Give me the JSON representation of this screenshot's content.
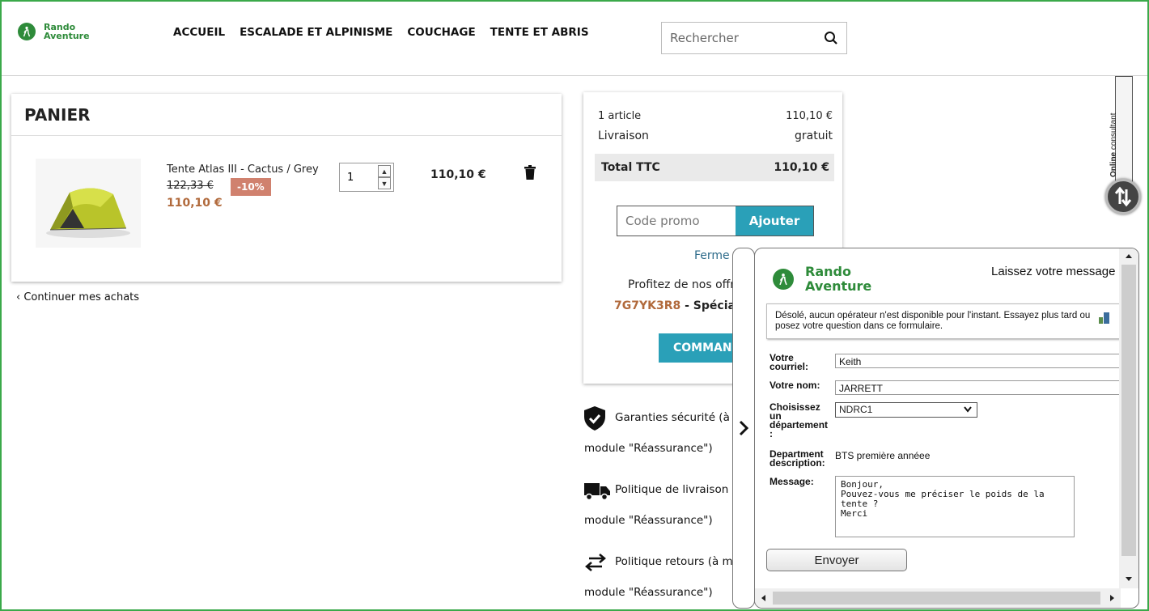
{
  "brand": {
    "line1": "Rando",
    "line2": "Aventure"
  },
  "nav": [
    "ACCUEIL",
    "ESCALADE ET ALPINISME",
    "COUCHAGE",
    "TENTE ET ABRIS"
  ],
  "search": {
    "placeholder": "Rechercher"
  },
  "cart": {
    "title": "PANIER",
    "product": {
      "name": "Tente Atlas III - Cactus / Grey",
      "old_price": "122,33 €",
      "discount": "-10%",
      "price": "110,10 €",
      "quantity": "1",
      "line_total": "110,10 €"
    },
    "continue_label": "Continuer mes achats"
  },
  "summary": {
    "items_label": "1 article",
    "items_value": "110,10 €",
    "shipping_label": "Livraison",
    "shipping_value": "gratuit",
    "total_label": "Total TTC",
    "total_value": "110,10 €",
    "promo_placeholder": "Code promo",
    "promo_button": "Ajouter",
    "close_label": "Ferme",
    "offers_text": "Profitez de nos offre",
    "promo_code": "7G7YK3R8",
    "promo_code_suffix": " - Spécial r",
    "order_button": "COMMAN"
  },
  "reassurance": [
    {
      "icon": "shield-check-icon",
      "title": "Garanties sécurité (à n",
      "sub": "module \"Réassurance\")"
    },
    {
      "icon": "truck-icon",
      "title": "Politique de livraison (",
      "sub": "module \"Réassurance\")"
    },
    {
      "icon": "exchange-arrows-icon",
      "title": "Politique retours (à mo",
      "sub": "module \"Réassurance\")"
    }
  ],
  "online_consultant": {
    "bold": "Online",
    "rest": " consultant"
  },
  "chat": {
    "brand_line1": "Rando",
    "brand_line2": "Aventure",
    "header": "Laissez votre message",
    "notice": "Désolé, aucun opérateur n'est disponible pour l'instant. Essayez plus tard ou posez votre question dans ce formulaire.",
    "email_label": "Votre courriel:",
    "email_value": "Keith",
    "name_label": "Votre nom:",
    "name_value": "JARRETT",
    "dept_label": "Choisissez un département :",
    "dept_value": "NDRC1",
    "desc_label": "Department description:",
    "desc_value": "BTS première annéee",
    "message_label": "Message:",
    "message_value": "Bonjour,\nPouvez-vous me préciser le poids de la tente ?\nMerci",
    "send_button": "Envoyer"
  },
  "colors": {
    "brand_green": "#2e8b3a",
    "accent_teal": "#2aa0b8",
    "price_brown": "#b16a3c",
    "discount_bg": "#d0816e",
    "frame_green": "#3aa94a"
  }
}
